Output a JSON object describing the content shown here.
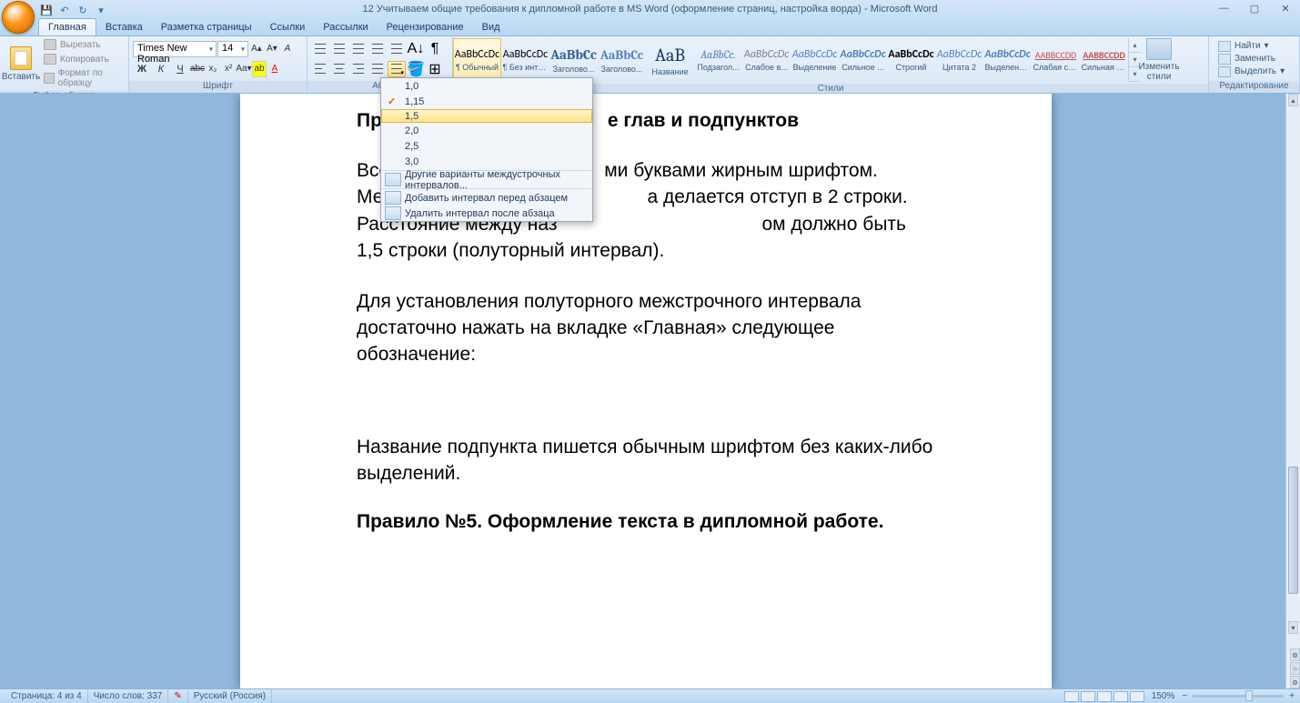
{
  "title": "12 Учитываем общие требования к дипломной работе в MS Word (оформление страниц, настройка ворда) - Microsoft Word",
  "qat": {
    "save": "💾",
    "undo": "↶",
    "redo": "↻"
  },
  "tabs": [
    "Главная",
    "Вставка",
    "Разметка страницы",
    "Ссылки",
    "Рассылки",
    "Рецензирование",
    "Вид"
  ],
  "clipboard": {
    "title": "Буфер обмена",
    "paste": "Вставить",
    "cut": "Вырезать",
    "copy": "Копировать",
    "formatPainter": "Формат по образцу"
  },
  "font": {
    "title": "Шрифт",
    "family": "Times New Roman",
    "size": "14"
  },
  "paragraph": {
    "title": "Абз"
  },
  "styleItems": [
    {
      "preview": "AaBbCcDc",
      "label": "¶ Обычный",
      "color": "#000",
      "bold": false,
      "font": "Calibri"
    },
    {
      "preview": "AaBbCcDc",
      "label": "¶ Без инте...",
      "color": "#000",
      "bold": false,
      "font": "Calibri"
    },
    {
      "preview": "AaBbCc",
      "label": "Заголово...",
      "color": "#365f91",
      "bold": true,
      "font": "Cambria",
      "size": "15px"
    },
    {
      "preview": "AaBbCc",
      "label": "Заголово...",
      "color": "#4f81bd",
      "bold": true,
      "font": "Cambria",
      "size": "14px"
    },
    {
      "preview": "AaB",
      "label": "Название",
      "color": "#17365d",
      "bold": false,
      "font": "Cambria",
      "size": "20px"
    },
    {
      "preview": "AaBbCc.",
      "label": "Подзагол...",
      "color": "#4f81bd",
      "bold": false,
      "font": "Cambria",
      "italic": true
    },
    {
      "preview": "AaBbCcDc",
      "label": "Слабое в...",
      "color": "#808080",
      "bold": false,
      "font": "Calibri",
      "italic": true
    },
    {
      "preview": "AaBbCcDc",
      "label": "Выделение",
      "color": "#4f81bd",
      "bold": false,
      "font": "Calibri",
      "italic": true
    },
    {
      "preview": "AaBbCcDc",
      "label": "Сильное ...",
      "color": "#4f81bd",
      "bold": true,
      "font": "Calibri",
      "italic": true
    },
    {
      "preview": "AaBbCcDc",
      "label": "Строгий",
      "color": "#000",
      "bold": true,
      "font": "Calibri"
    },
    {
      "preview": "AaBbCcDc",
      "label": "Цитата 2",
      "color": "#4f81bd",
      "bold": false,
      "font": "Calibri",
      "italic": true
    },
    {
      "preview": "AaBbCcDc",
      "label": "Выделенн...",
      "color": "#4f81bd",
      "bold": true,
      "font": "Calibri",
      "italic": true
    },
    {
      "preview": "AABBCCDD",
      "label": "Слабая сс...",
      "color": "#c0504d",
      "bold": false,
      "font": "Calibri",
      "under": true,
      "size": "10px"
    },
    {
      "preview": "AABBCCDD",
      "label": "Сильная с...",
      "color": "#c0504d",
      "bold": true,
      "font": "Calibri",
      "under": true,
      "size": "10px"
    }
  ],
  "styles": {
    "title": "Стили",
    "changeStyles": "Изменить стили"
  },
  "editing": {
    "title": "Редактирование",
    "find": "Найти",
    "replace": "Заменить",
    "select": "Выделить"
  },
  "spacing": {
    "values": [
      "1,0",
      "1,15",
      "1,5",
      "2,0",
      "2,5",
      "3,0"
    ],
    "checked": 1,
    "hovered": 2,
    "other": "Другие варианты междустрочных интервалов...",
    "addBefore": "Добавить интервал перед абзацем",
    "removeAfter": "Удалить интервал после абзаца"
  },
  "document": {
    "heading_vis_pre": "Пр",
    "heading_vis_post": "е глав  и подпунктов",
    "p1_a": "Все",
    "p1_b": "ми буквами жирным шрифтом. Между наз",
    "p1_c": "а делается отступ в 2 строки. Расстояние между наз",
    "p1_d": "ом должно быть 1,5 строки (полуторный интервал).",
    "p2": "Для установления полуторного межстрочного интервала достаточно нажать на вкладке «Главная» следующее обозначение:",
    "p3": "Название подпункта пишется обычным шрифтом без каких-либо выделений.",
    "p4": "Правило №5. Оформление текста в дипломной работе."
  },
  "status": {
    "page": "Страница: 4 из 4",
    "words": "Число слов: 337",
    "lang": "Русский (Россия)",
    "zoom": "150%"
  }
}
